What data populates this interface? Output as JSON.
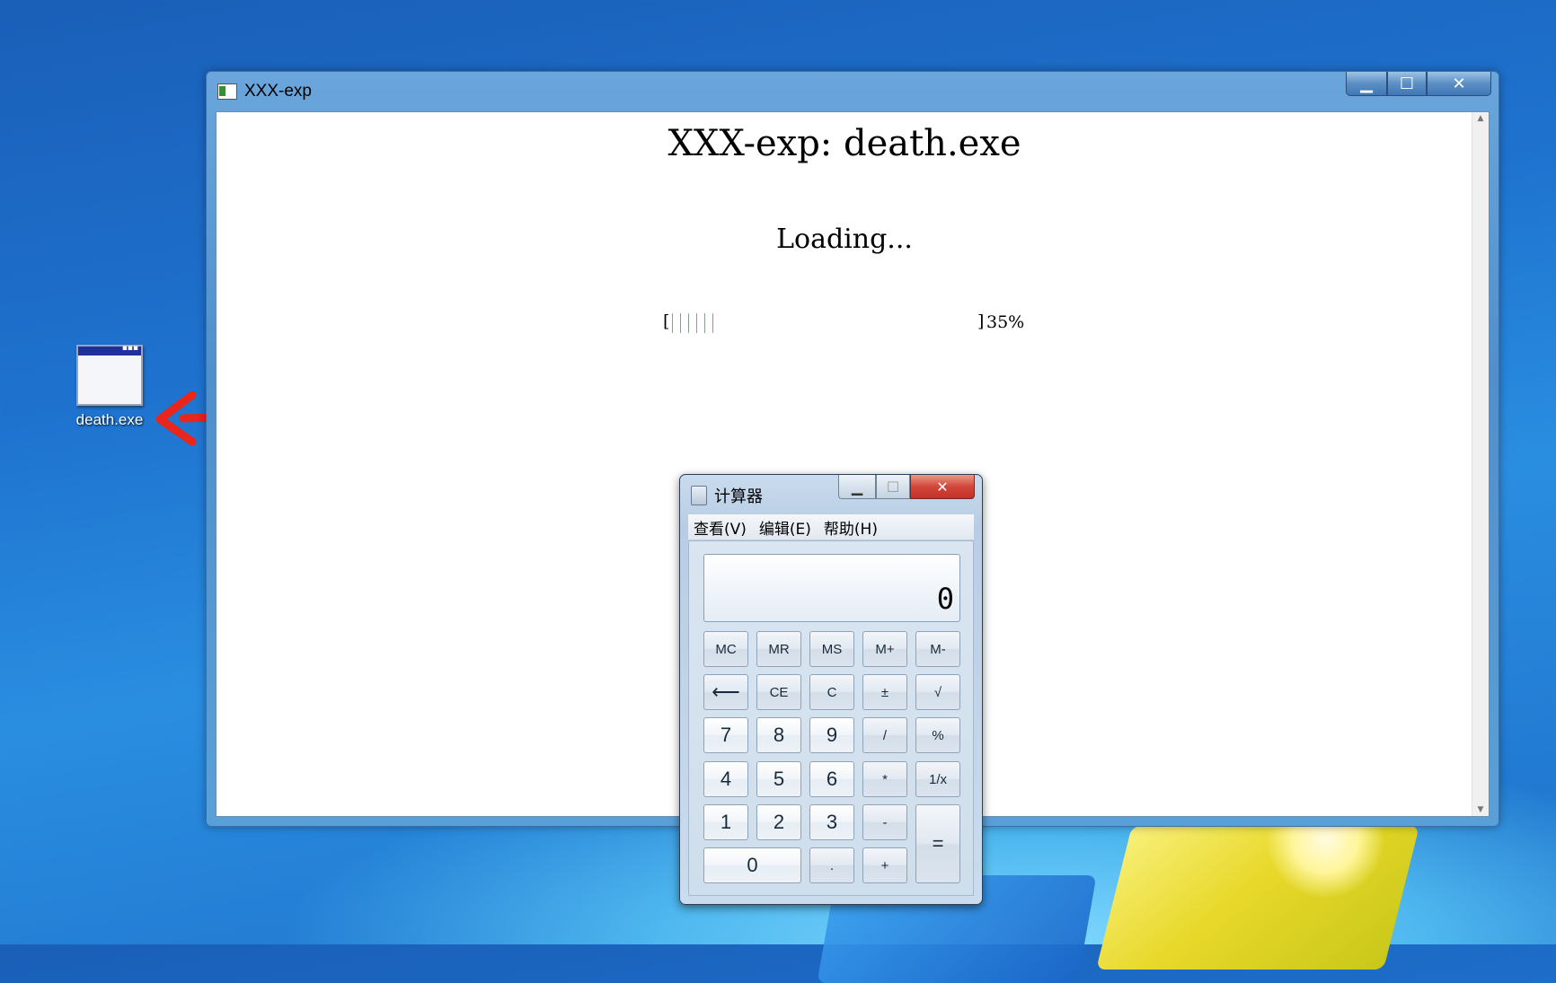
{
  "desktop": {
    "icon_label": "death.exe",
    "icon_name": "window-app-icon",
    "arrow_color": "#e8261c"
  },
  "main_window": {
    "title": "XXX-exp",
    "console": {
      "title": "XXX-exp: death.exe",
      "status": "Loading...",
      "progress": {
        "left_bracket": "[",
        "right_bracket": "]",
        "percent_text": "35%",
        "value": 0.35,
        "tick_count": 6
      }
    }
  },
  "calculator": {
    "title": "计算器",
    "menu": [
      "查看(V)",
      "编辑(E)",
      "帮助(H)"
    ],
    "display_value": "0",
    "keys": {
      "mc": "MC",
      "mr": "MR",
      "ms": "MS",
      "mplus": "M+",
      "mminus": "M-",
      "back": "⟵",
      "ce": "CE",
      "c": "C",
      "plusminus": "±",
      "sqrt": "√",
      "d7": "7",
      "d8": "8",
      "d9": "9",
      "div": "/",
      "pct": "%",
      "d4": "4",
      "d5": "5",
      "d6": "6",
      "mul": "*",
      "recip": "1/x",
      "d1": "1",
      "d2": "2",
      "d3": "3",
      "sub": "-",
      "eq": "=",
      "d0": "0",
      "dot": ".",
      "add": "+"
    }
  }
}
